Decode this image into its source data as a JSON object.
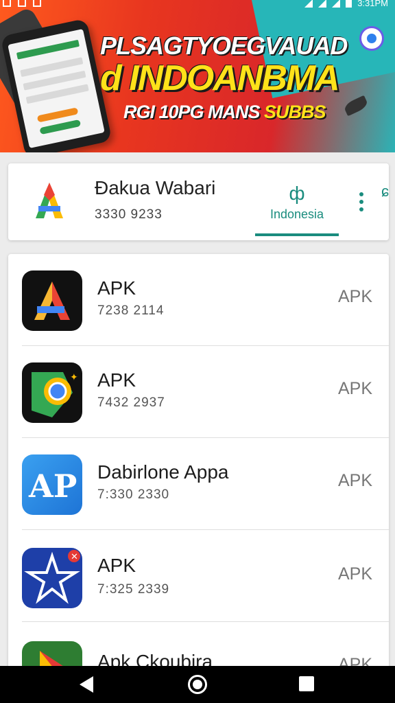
{
  "status_bar": {
    "time": "3:31PM"
  },
  "banner": {
    "line1": "PLSAGTYOEGVAUAD",
    "line2": "d INDOANBMA",
    "line3_a": "RGI 10PG MANS ",
    "line3_b": "SUBBS"
  },
  "top_card": {
    "app_name": "Đakua Wabari",
    "app_number": "3330 9233",
    "tab_label": "Indonesia",
    "tab_icon": "cactus-icon",
    "colors": {
      "accent": "#1a8c7e"
    }
  },
  "apps": [
    {
      "title": "APK",
      "meta": "7238 2114",
      "tag": "APK",
      "icon": "orange-a-icon"
    },
    {
      "title": "APK",
      "meta": "7432 2937",
      "tag": "APK",
      "icon": "browser-icon"
    },
    {
      "title": "Dabirlone Appa",
      "meta": "7:330 2330",
      "tag": "APK",
      "icon": "ap-icon"
    },
    {
      "title": "APK",
      "meta": "7:325 2339",
      "tag": "APK",
      "icon": "star-brush-icon"
    },
    {
      "title": "Apk Ckoubira",
      "meta": "",
      "tag": "APK",
      "icon": "play-icon"
    }
  ]
}
